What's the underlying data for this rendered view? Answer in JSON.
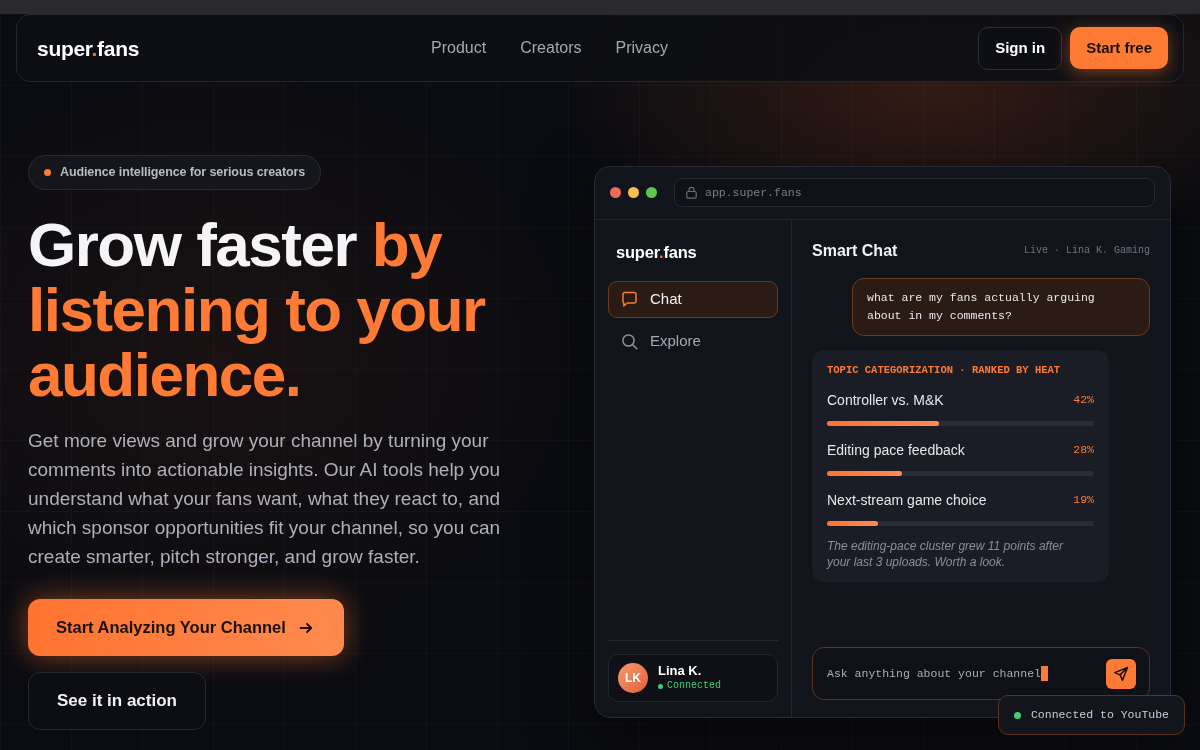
{
  "top_nav": {
    "logo": {
      "lead": "super",
      "dot": ".",
      "tail": "fans"
    },
    "links": [
      "Product",
      "Creators",
      "Privacy"
    ],
    "sign_in": "Sign in",
    "cta": "Start free"
  },
  "hero": {
    "tagline": "Audience intelligence for serious creators",
    "heading": {
      "lead": "Grow faster",
      "accent": "by listening to your audience."
    },
    "paragraph": "Get more views and grow your channel by turning your comments into actionable insights. Our AI tools help you understand what your fans want, what they react to, and which sponsor opportunities fit your channel, so you can create smarter, pitch stronger, and grow faster.",
    "primary_button": "Start Analyzing Your Channel",
    "secondary_button": "See it in action"
  },
  "app_preview": {
    "address": "app.super.fans",
    "sidebar": {
      "logo": {
        "lead": "super",
        "dot": ".",
        "tail": "fans"
      },
      "items": [
        {
          "label": "Chat",
          "selected": true
        },
        {
          "label": "Explore",
          "selected": false
        }
      ],
      "user": {
        "initials": "LK",
        "name": "Lina K.",
        "status": "Connected"
      }
    },
    "chat": {
      "title": "Smart Chat",
      "meta": "Live · Lina K. Gaming",
      "user_message": "what are my fans actually arguing about in my comments?",
      "topic_card": {
        "heading": "TOPIC CATEGORIZATION · RANKED BY HEAT",
        "topics": [
          {
            "label": "Controller vs. M&K",
            "reading": "42%",
            "level": 0.42
          },
          {
            "label": "Editing pace feedback",
            "reading": "28%",
            "level": 0.28
          },
          {
            "label": "Next-stream game choice",
            "reading": "19%",
            "level": 0.19
          }
        ],
        "note": "The editing-pace cluster grew 11 points after your last 3 uploads. Worth a look."
      },
      "input": {
        "value": "Ask anything about your channel"
      }
    }
  },
  "toast": {
    "text": "Connected to YouTube"
  }
}
